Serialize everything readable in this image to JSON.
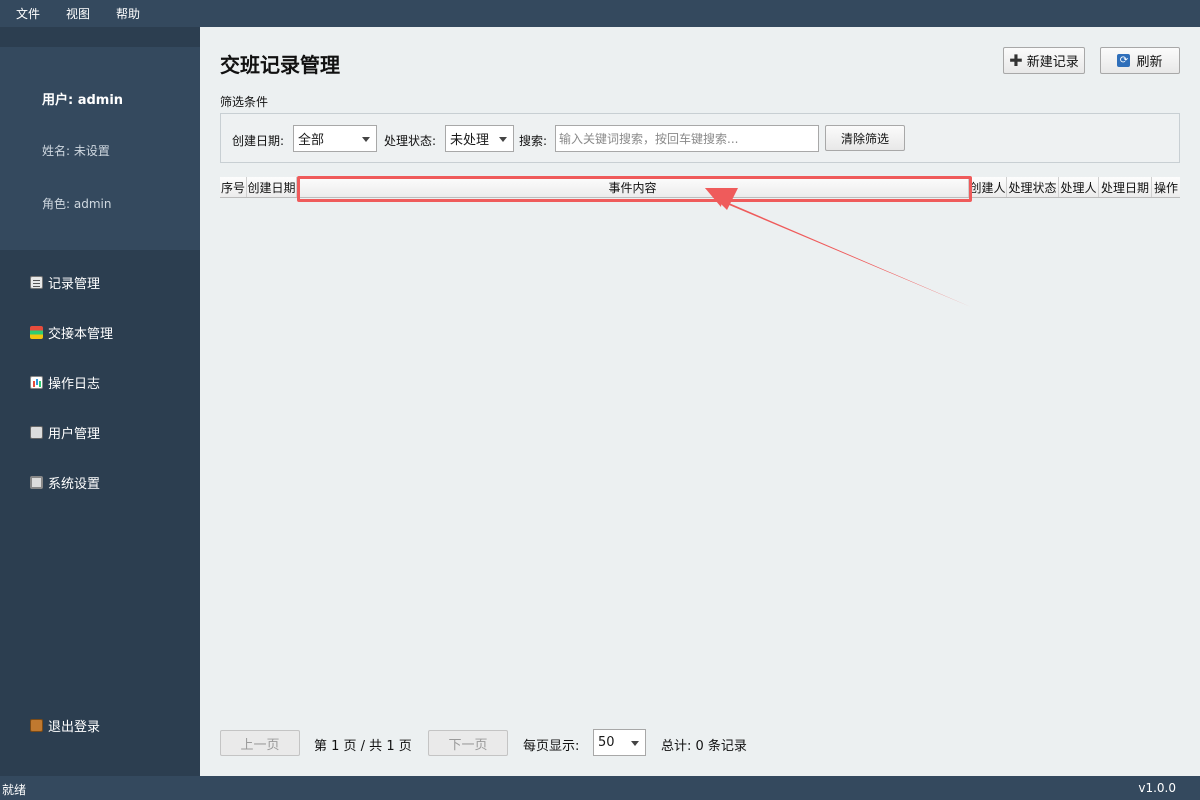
{
  "menu": [
    "文件",
    "视图",
    "帮助"
  ],
  "user_panel": {
    "user": "用户: admin",
    "name": "姓名: 未设置",
    "role": "角色: admin"
  },
  "nav": [
    {
      "label": "记录管理",
      "icon": "clipboard-icon"
    },
    {
      "label": "交接本管理",
      "icon": "books-icon"
    },
    {
      "label": "操作日志",
      "icon": "chart-icon"
    },
    {
      "label": "用户管理",
      "icon": "user-icon"
    },
    {
      "label": "系统设置",
      "icon": "gear-icon"
    }
  ],
  "logout_label": "退出登录",
  "page_title": "交班记录管理",
  "toolbar": {
    "new_label": "新建记录",
    "refresh_label": "刷新"
  },
  "filter": {
    "section_label": "筛选条件",
    "date_label": "创建日期:",
    "date_value": "全部",
    "status_label": "处理状态:",
    "status_value": "未处理",
    "search_label": "搜索:",
    "search_placeholder": "输入关键词搜索，按回车键搜索...",
    "clear_label": "清除筛选"
  },
  "table": {
    "columns": [
      "序号",
      "创建日期",
      "事件内容",
      "创建人",
      "处理状态",
      "处理人",
      "处理日期",
      "操作"
    ],
    "rows": []
  },
  "pager": {
    "prev_label": "上一页",
    "page_info": "第 1 页 / 共 1 页",
    "next_label": "下一页",
    "per_page_label": "每页显示:",
    "per_page_value": "50",
    "total_label": "总计: 0 条记录"
  },
  "status": {
    "left": "就绪",
    "version": "v1.0.0"
  },
  "colors": {
    "highlight": "#ef5b5b",
    "sidebar": "#2c3e50",
    "panel": "#34495e"
  }
}
